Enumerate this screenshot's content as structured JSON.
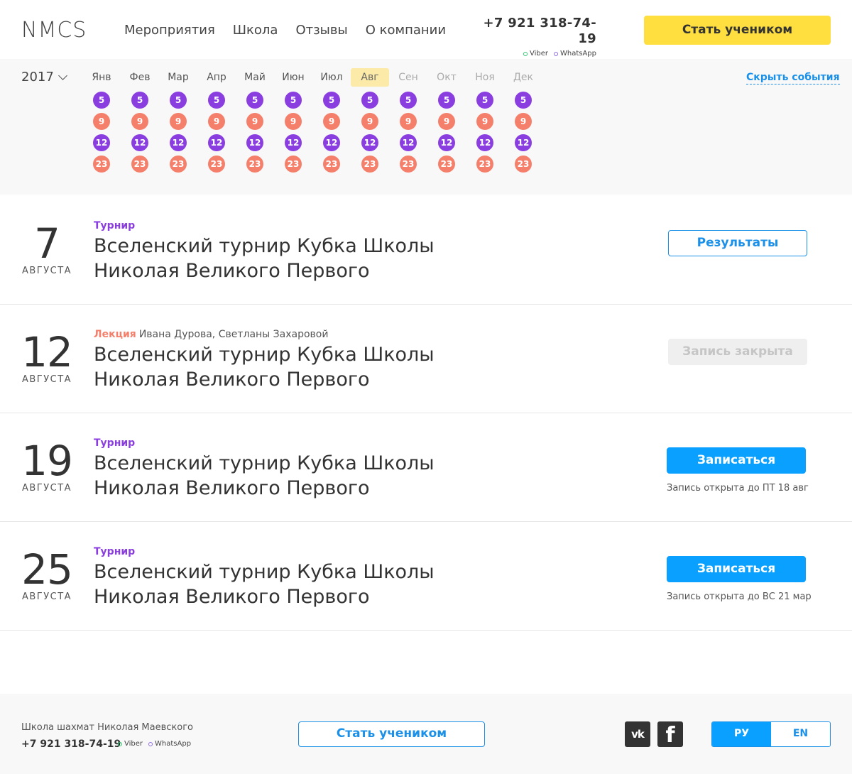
{
  "header": {
    "logo": "NMCS",
    "nav": [
      "Мероприятия",
      "Школа",
      "Отзывы",
      "О компании"
    ],
    "phone": "+7 921 318-74-19",
    "viber": "Viber",
    "whatsapp": "WhatsApp",
    "cta": "Стать учеником"
  },
  "calendar": {
    "year": "2017",
    "hide_events": "Скрыть события",
    "active_month_index": 7,
    "months": [
      {
        "name": "Янв",
        "days": [
          "5",
          "9",
          "12",
          "23"
        ]
      },
      {
        "name": "Фев",
        "days": [
          "5",
          "9",
          "12",
          "23"
        ]
      },
      {
        "name": "Мар",
        "days": [
          "5",
          "9",
          "12",
          "23"
        ]
      },
      {
        "name": "Апр",
        "days": [
          "5",
          "9",
          "12",
          "23"
        ]
      },
      {
        "name": "Май",
        "days": [
          "5",
          "9",
          "12",
          "23"
        ]
      },
      {
        "name": "Июн",
        "days": [
          "5",
          "9",
          "12",
          "23"
        ]
      },
      {
        "name": "Июл",
        "days": [
          "5",
          "9",
          "12",
          "23"
        ]
      },
      {
        "name": "Авг",
        "days": [
          "5",
          "9",
          "12",
          "23"
        ]
      },
      {
        "name": "Сен",
        "days": [
          "5",
          "9",
          "12",
          "23"
        ]
      },
      {
        "name": "Окт",
        "days": [
          "5",
          "9",
          "12",
          "23"
        ]
      },
      {
        "name": "Ноя",
        "days": [
          "5",
          "9",
          "12",
          "23"
        ]
      },
      {
        "name": "Дек",
        "days": [
          "5",
          "9",
          "12",
          "23"
        ]
      }
    ],
    "day_colors": {
      "tournament": "#8a3ee0",
      "lecture": "#f4806c"
    }
  },
  "events": [
    {
      "day": "7",
      "month": "августа",
      "type": "Турнир",
      "authors": "",
      "title_line1": "Вселенский турнир Кубка Школы",
      "title_line2": "Николая Великого Первого",
      "button": "Результаты",
      "note": ""
    },
    {
      "day": "12",
      "month": "августа",
      "type": "Лекция",
      "authors": "Ивана Дурова, Светланы Захаровой",
      "title_line1": "Вселенский турнир Кубка Школы",
      "title_line2": "Николая Великого Первого",
      "button": "Запись закрыта",
      "note": ""
    },
    {
      "day": "19",
      "month": "августа",
      "type": "Турнир",
      "authors": "",
      "title_line1": "Вселенский турнир Кубка Школы",
      "title_line2": "Николая Великого Первого",
      "button": "Записаться",
      "note": "Запись открыта до ПТ 18 авг"
    },
    {
      "day": "25",
      "month": "августа",
      "type": "Турнир",
      "authors": "",
      "title_line1": "Вселенский турнир Кубка Школы",
      "title_line2": "Николая Великого Первого",
      "button": "Записаться",
      "note": "Запись открыта до ВС 21 мар"
    }
  ],
  "footer": {
    "school": "Школа шахмат Николая Маевского",
    "phone": "+7 921 318-74-19",
    "viber": "Viber",
    "whatsapp": "WhatsApp",
    "cta": "Стать учеником",
    "vk": "vk",
    "fb": "f",
    "lang_ru": "РУ",
    "lang_en": "EN"
  },
  "colors": {
    "accent_yellow": "#ffdf3f",
    "accent_blue": "#0aa0ff",
    "tournament_purple": "#8a3ee0",
    "lecture_salmon": "#f4806c"
  }
}
